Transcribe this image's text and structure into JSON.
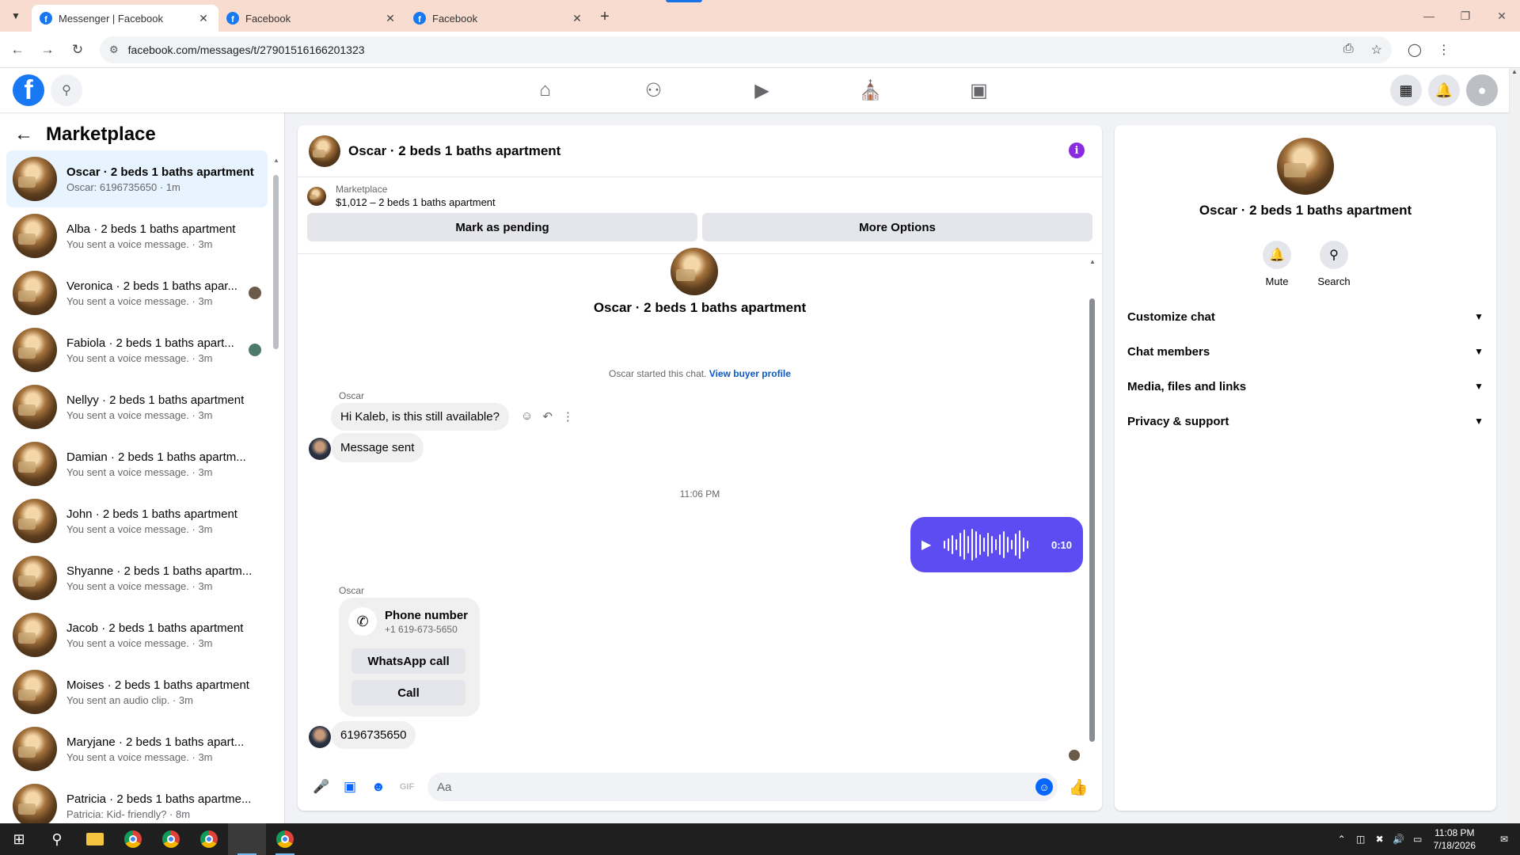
{
  "browser": {
    "tabs": [
      {
        "title": "Messenger | Facebook",
        "active": true
      },
      {
        "title": "Facebook",
        "active": false
      },
      {
        "title": "Facebook",
        "active": false
      }
    ],
    "url": "facebook.com/messages/t/27901516166201323"
  },
  "sidebar": {
    "title": "Marketplace",
    "conversations": [
      {
        "name": "Oscar · 2 beds 1 baths apartment",
        "sub": "Oscar: 6196735650 · 1m",
        "active": true
      },
      {
        "name": "Alba · 2 beds 1 baths apartment",
        "sub": "You sent a voice message. · 3m"
      },
      {
        "name": "Veronica · 2 beds 1 baths apar...",
        "sub": "You sent a voice message. · 3m",
        "seen": true
      },
      {
        "name": "Fabiola · 2 beds 1 baths apart...",
        "sub": "You sent a voice message. · 3m",
        "seen": true
      },
      {
        "name": "Nellyy · 2 beds 1 baths apartment",
        "sub": "You sent a voice message. · 3m"
      },
      {
        "name": "Damian · 2 beds 1 baths apartm...",
        "sub": "You sent a voice message. · 3m"
      },
      {
        "name": "John · 2 beds 1 baths apartment",
        "sub": "You sent a voice message. · 3m"
      },
      {
        "name": "Shyanne · 2 beds 1 baths apartm...",
        "sub": "You sent a voice message. · 3m"
      },
      {
        "name": "Jacob · 2 beds 1 baths apartment",
        "sub": "You sent a voice message. · 3m"
      },
      {
        "name": "Moises · 2 beds 1 baths apartment",
        "sub": "You sent an audio clip. · 3m"
      },
      {
        "name": "Maryjane · 2 beds 1 baths apart...",
        "sub": "You sent a voice message. · 3m"
      },
      {
        "name": "Patricia · 2 beds 1 baths apartme...",
        "sub": "Patricia: Kid- friendly? · 8m"
      }
    ]
  },
  "chat": {
    "title": "Oscar · 2 beds 1 baths apartment",
    "marketplace_label": "Marketplace",
    "listing": "$1,012 – 2 beds 1 baths apartment",
    "mark_pending": "Mark as pending",
    "more_options": "More Options",
    "intro_name": "Oscar · 2 beds 1 baths apartment",
    "started_text": "Oscar started this chat.",
    "view_buyer": "View buyer profile",
    "sender1": "Oscar",
    "msg1": "Hi Kaleb, is this still available?",
    "msg2": "Message sent",
    "timestamp": "11:06 PM",
    "voice_duration": "0:10",
    "sender2": "Oscar",
    "phone_title": "Phone number",
    "phone_number": "+1 619-673-5650",
    "whatsapp_call": "WhatsApp call",
    "call": "Call",
    "msg3": "6196735650",
    "composer_placeholder": "Aa"
  },
  "panel": {
    "name": "Oscar · 2 beds 1 baths apartment",
    "mute": "Mute",
    "search": "Search",
    "sections": [
      "Customize chat",
      "Chat members",
      "Media, files and links",
      "Privacy & support"
    ]
  },
  "taskbar": {
    "time": "11:08 PM",
    "date": "7/18/2026"
  },
  "colors": {
    "accent": "#0866ff",
    "voice_bubble": "#5c4cf2",
    "info": "#8a2be2",
    "tab_bar": "#f8dccf"
  }
}
